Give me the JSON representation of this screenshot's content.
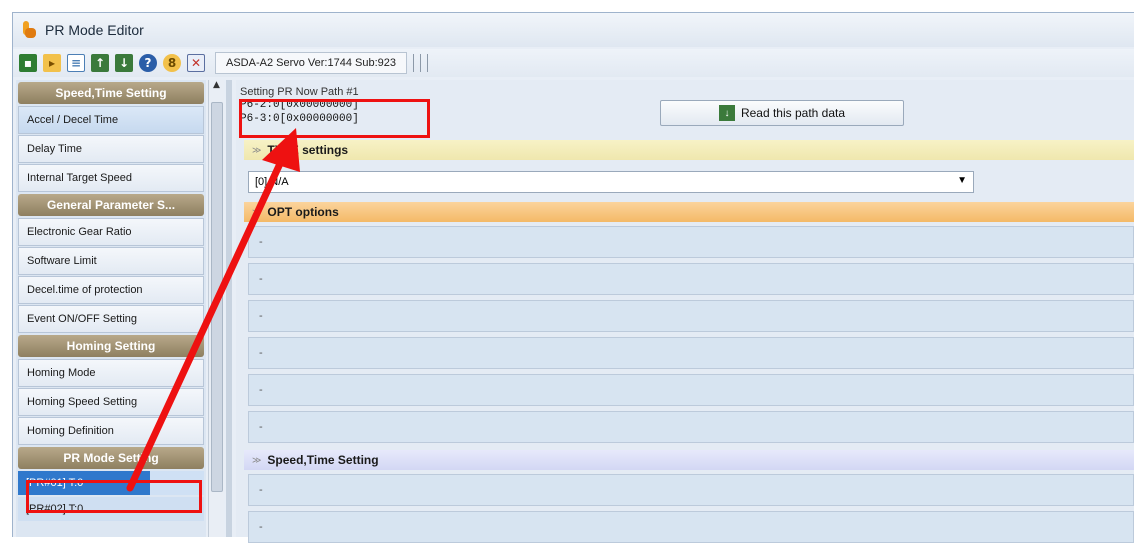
{
  "window": {
    "title": "PR Mode Editor"
  },
  "toolbar": {
    "icons": [
      "save-icon",
      "open-icon",
      "new-file-icon",
      "upload-icon",
      "download-icon",
      "help-icon",
      "lock-icon",
      "exit-icon"
    ],
    "status": "ASDA-A2 Servo Ver:1744 Sub:923"
  },
  "sidebar": {
    "sections": [
      {
        "header": "Speed,Time Setting",
        "items": [
          "Accel / Decel Time",
          "Delay Time",
          "Internal Target Speed"
        ]
      },
      {
        "header": "General Parameter S...",
        "items": [
          "Electronic Gear Ratio",
          "Software Limit",
          "Decel.time of protection",
          "Event ON/OFF Setting"
        ]
      },
      {
        "header": "Homing Setting",
        "items": [
          "Homing Mode",
          "Homing Speed Setting",
          "Homing Definition"
        ]
      },
      {
        "header": "PR Mode Setting",
        "items": []
      }
    ],
    "pr_items": [
      {
        "label": "[PR#01]   T:0",
        "selected": true
      },
      {
        "label": "[PR#02]   T:0",
        "selected": false
      }
    ]
  },
  "main": {
    "path_title": "Setting PR Now Path #1",
    "path_line1": "P6-2:0[0x00000000]",
    "path_line2": "P6-3:0[0x00000000]",
    "read_button": "Read this path data",
    "type_section": "TYPE settings",
    "type_value": "[0] N/A",
    "opt_section": "OPT options",
    "opt_rows": [
      "-",
      "-",
      "-",
      "-",
      "-",
      "-"
    ],
    "speed_section": "Speed,Time Setting",
    "speed_rows": [
      "-",
      "-"
    ]
  },
  "colors": {
    "highlight": "#ee1111",
    "pr_selected": "#2f78cc",
    "sidebar_header": "#8e7f60"
  }
}
